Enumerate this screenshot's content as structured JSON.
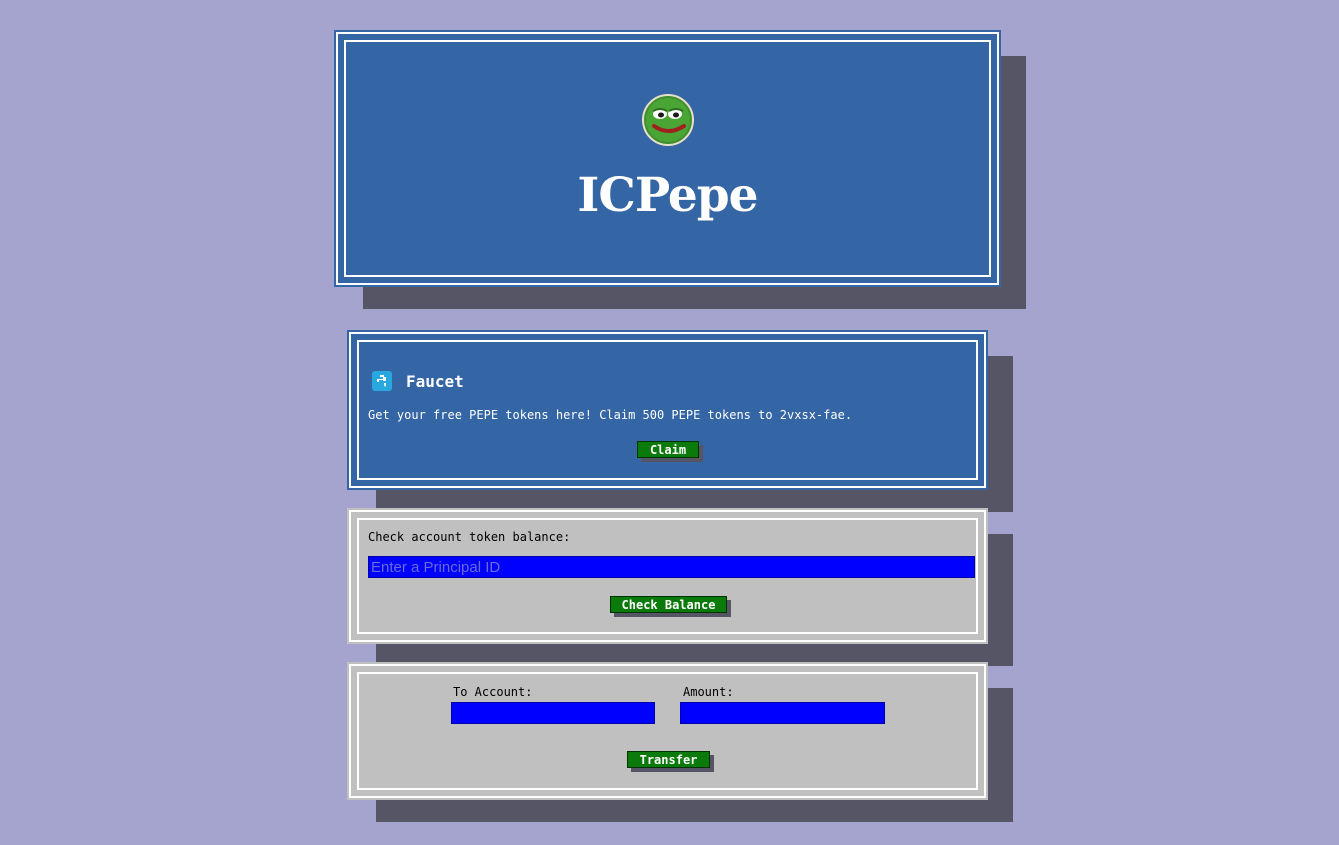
{
  "header": {
    "logo_icon": "pepe-frog-avatar-icon",
    "title": "ICPepe"
  },
  "faucet": {
    "icon": "faucet-icon",
    "title": "Faucet",
    "description": "Get your free PEPE tokens here! Claim 500 PEPE tokens to 2vxsx-fae.",
    "claim_label": "Claim"
  },
  "balance": {
    "label": "Check account token balance:",
    "input_placeholder": "Enter a Principal ID",
    "input_value": "",
    "button_label": "Check Balance"
  },
  "transfer": {
    "to_label": "To Account:",
    "amount_label": "Amount:",
    "to_value": "",
    "amount_value": "",
    "button_label": "Transfer"
  },
  "colors": {
    "background": "#a4a4cf",
    "card_blue": "#3465a4",
    "card_gray": "#c0c0c0",
    "input_bg": "#0000ff",
    "button_bg": "#0a7a0a",
    "shadow": "#555566"
  }
}
